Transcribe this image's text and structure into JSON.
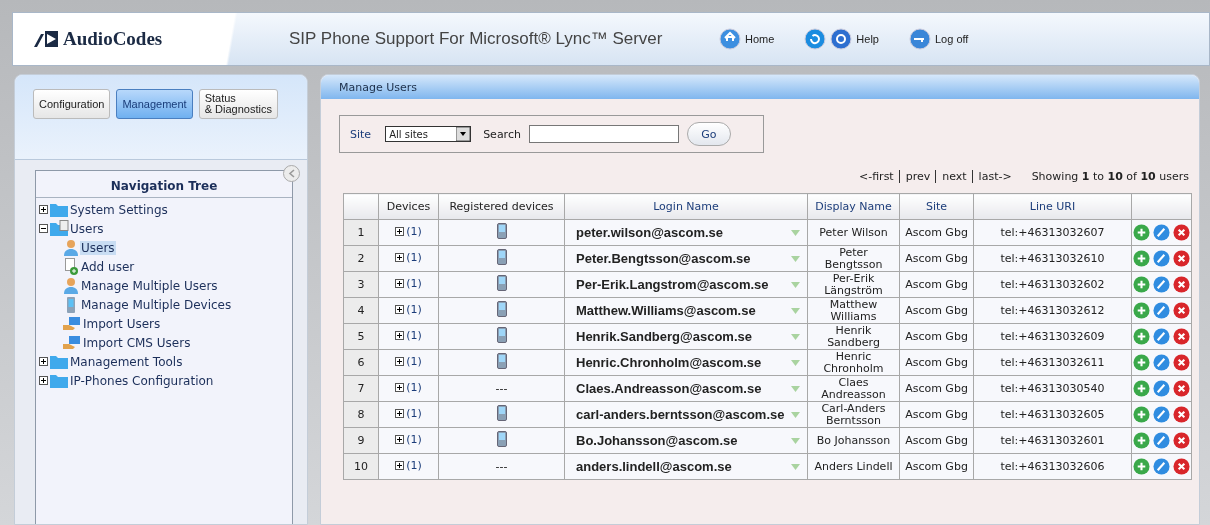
{
  "header": {
    "logo": "AudioCodes",
    "title": "SIP Phone Support For Microsoft® Lync™ Server",
    "links": [
      {
        "kind": "home",
        "label": "Home"
      },
      {
        "kind": "refresh"
      },
      {
        "kind": "help",
        "label": "Help"
      },
      {
        "kind": "logoff",
        "label": "Log off"
      }
    ]
  },
  "mode_tabs": [
    {
      "label": "Configuration",
      "selected": false
    },
    {
      "label": "Management",
      "selected": true
    },
    {
      "label": "Status\n& Diagnostics",
      "selected": false
    }
  ],
  "nav_tree": {
    "title": "Navigation Tree",
    "items": [
      {
        "label": "System Settings",
        "kind": "folder",
        "expanded": false,
        "selected": false
      },
      {
        "label": "Users",
        "kind": "folder-doc",
        "expanded": true,
        "selected": false,
        "children": [
          {
            "label": "Users",
            "kind": "user",
            "selected": true
          },
          {
            "label": "Add user",
            "kind": "add",
            "selected": false
          },
          {
            "label": "Manage Multiple Users",
            "kind": "user",
            "selected": false
          },
          {
            "label": "Manage Multiple Devices",
            "kind": "device",
            "selected": false
          },
          {
            "label": "Import Users",
            "kind": "import",
            "selected": false
          },
          {
            "label": "Import CMS Users",
            "kind": "import",
            "selected": false
          }
        ]
      },
      {
        "label": "Management Tools",
        "kind": "folder",
        "expanded": false,
        "selected": false
      },
      {
        "label": "IP-Phones Configuration",
        "kind": "folder",
        "expanded": false,
        "selected": false
      }
    ]
  },
  "panel": {
    "title": "Manage Users",
    "filter": {
      "site_label": "Site",
      "site_value": "All sites",
      "search_label": "Search",
      "go": "Go"
    },
    "pager": [
      "<-first",
      "prev",
      "next",
      "last->"
    ],
    "showing": "Showing **1** to **10** of **10** users",
    "table": {
      "columns": [
        "",
        "Devices",
        "Registered devices",
        "Login Name",
        "Display Name",
        "Site",
        "Line URI",
        ""
      ],
      "rows": [
        {
          "index": "1",
          "devices": "(1)",
          "registered": true,
          "login": "peter.wilson@ascom.se",
          "display": "Peter Wilson",
          "site": "Ascom Gbg",
          "uri": "tel:+46313032607"
        },
        {
          "index": "2",
          "devices": "(1)",
          "registered": true,
          "login": "Peter.Bengtsson@ascom.se",
          "display": "Peter Bengtsson",
          "site": "Ascom Gbg",
          "uri": "tel:+46313032610"
        },
        {
          "index": "3",
          "devices": "(1)",
          "registered": true,
          "login": "Per-Erik.Langstrom@ascom.se",
          "display": "Per-Erik Längström",
          "site": "Ascom Gbg",
          "uri": "tel:+46313032602"
        },
        {
          "index": "4",
          "devices": "(1)",
          "registered": true,
          "login": "Matthew.Williams@ascom.se",
          "display": "Matthew Williams",
          "site": "Ascom Gbg",
          "uri": "tel:+46313032612"
        },
        {
          "index": "5",
          "devices": "(1)",
          "registered": true,
          "login": "Henrik.Sandberg@ascom.se",
          "display": "Henrik Sandberg",
          "site": "Ascom Gbg",
          "uri": "tel:+46313032609"
        },
        {
          "index": "6",
          "devices": "(1)",
          "registered": true,
          "login": "Henric.Chronholm@ascom.se",
          "display": "Henric Chronholm",
          "site": "Ascom Gbg",
          "uri": "tel:+46313032611"
        },
        {
          "index": "7",
          "devices": "(1)",
          "registered": false,
          "no_device": "---",
          "login": "Claes.Andreasson@ascom.se",
          "display": "Claes Andreasson",
          "site": "Ascom Gbg",
          "uri": "tel:+46313030540"
        },
        {
          "index": "8",
          "devices": "(1)",
          "registered": true,
          "login": "carl-anders.berntsson@ascom.se",
          "display": "Carl-Anders Berntsson",
          "site": "Ascom Gbg",
          "uri": "tel:+46313032605"
        },
        {
          "index": "9",
          "devices": "(1)",
          "registered": true,
          "login": "Bo.Johansson@ascom.se",
          "display": "Bo Johansson",
          "site": "Ascom Gbg",
          "uri": "tel:+46313032601"
        },
        {
          "index": "10",
          "devices": "(1)",
          "registered": false,
          "no_device": "---",
          "login": "anders.lindell@ascom.se",
          "display": "Anders Lindell",
          "site": "Ascom Gbg",
          "uri": "tel:+46313032606"
        }
      ]
    }
  }
}
